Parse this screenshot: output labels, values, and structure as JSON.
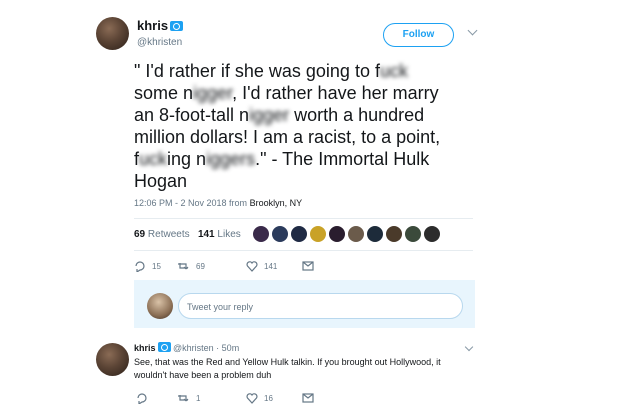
{
  "tweet": {
    "name": "khris",
    "handle": "@khristen",
    "follow_label": "Follow",
    "text_segments": [
      {
        "t": "\" I'd rather if she was going to f",
        "blur": false
      },
      {
        "t": "uck",
        "blur": true
      },
      {
        "t": "\nsome n",
        "blur": false
      },
      {
        "t": "igger",
        "blur": true
      },
      {
        "t": ", I'd rather have her marry\nan 8-foot-tall n",
        "blur": false
      },
      {
        "t": "igger",
        "blur": true
      },
      {
        "t": " worth a hundred\nmillion dollars! I am a racist, to a point,\nf",
        "blur": false
      },
      {
        "t": "uck",
        "blur": true
      },
      {
        "t": "ing n",
        "blur": false
      },
      {
        "t": "iggers",
        "blur": true
      },
      {
        "t": ".\"  - The Immortal Hulk\nHogan",
        "blur": false
      }
    ],
    "timestamp": "12:06 PM - 2 Nov 2018 from",
    "location": "Brooklyn, NY",
    "retweets_count": "69",
    "retweets_label": "Retweets",
    "likes_count": "141",
    "likes_label": "Likes",
    "likers_count": 10,
    "actions": {
      "replies": "15",
      "retweets": "69",
      "likes": "141"
    }
  },
  "reply_box": {
    "placeholder": "Tweet your reply"
  },
  "reply": {
    "name": "khris",
    "handle_time": "@khristen · 50m",
    "text": "See, that was the Red and Yellow Hulk talkin. If you brought out Hollywood, it wouldn't have been a problem duh",
    "actions": {
      "replies": "",
      "retweets": "1",
      "likes": "16"
    }
  },
  "colors": {
    "accent": "#1da1f2",
    "muted": "#657786"
  }
}
